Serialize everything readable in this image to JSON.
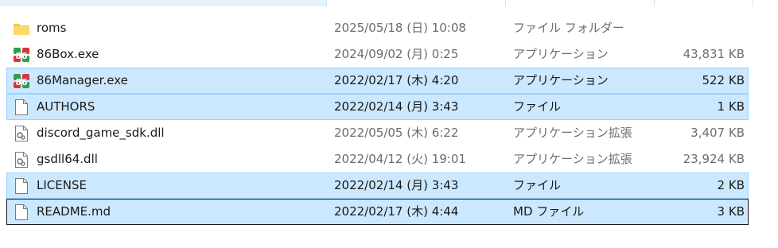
{
  "files": [
    {
      "name": "roms",
      "date": "2025/05/18 (日) 10:08",
      "type": "ファイル フォルダー",
      "size": "",
      "icon": "folder-icon",
      "state": "normal"
    },
    {
      "name": "86Box.exe",
      "date": "2024/09/02 (月) 0:25",
      "type": "アプリケーション",
      "size": "43,831 KB",
      "icon": "app-icon",
      "state": "normal"
    },
    {
      "name": "86Manager.exe",
      "date": "2022/02/17 (木) 4:20",
      "type": "アプリケーション",
      "size": "522 KB",
      "icon": "app-icon",
      "state": "selected"
    },
    {
      "name": "AUTHORS",
      "date": "2022/02/14 (月) 3:43",
      "type": "ファイル",
      "size": "1 KB",
      "icon": "file-icon",
      "state": "selected"
    },
    {
      "name": "discord_game_sdk.dll",
      "date": "2022/05/05 (木) 6:22",
      "type": "アプリケーション拡張",
      "size": "3,407 KB",
      "icon": "dll-icon",
      "state": "normal"
    },
    {
      "name": "gsdll64.dll",
      "date": "2022/04/12 (火) 19:01",
      "type": "アプリケーション拡張",
      "size": "23,924 KB",
      "icon": "dll-icon",
      "state": "normal"
    },
    {
      "name": "LICENSE",
      "date": "2022/02/14 (月) 3:43",
      "type": "ファイル",
      "size": "2 KB",
      "icon": "file-icon",
      "state": "selected"
    },
    {
      "name": "README.md",
      "date": "2022/02/17 (木) 4:44",
      "type": "MD ファイル",
      "size": "3 KB",
      "icon": "file-icon",
      "state": "focused"
    }
  ],
  "colors": {
    "selection_bg": "#cce8ff",
    "selection_border": "#99d1ff",
    "focus_border": "#1a1a1a",
    "folder": "#f8c848"
  }
}
